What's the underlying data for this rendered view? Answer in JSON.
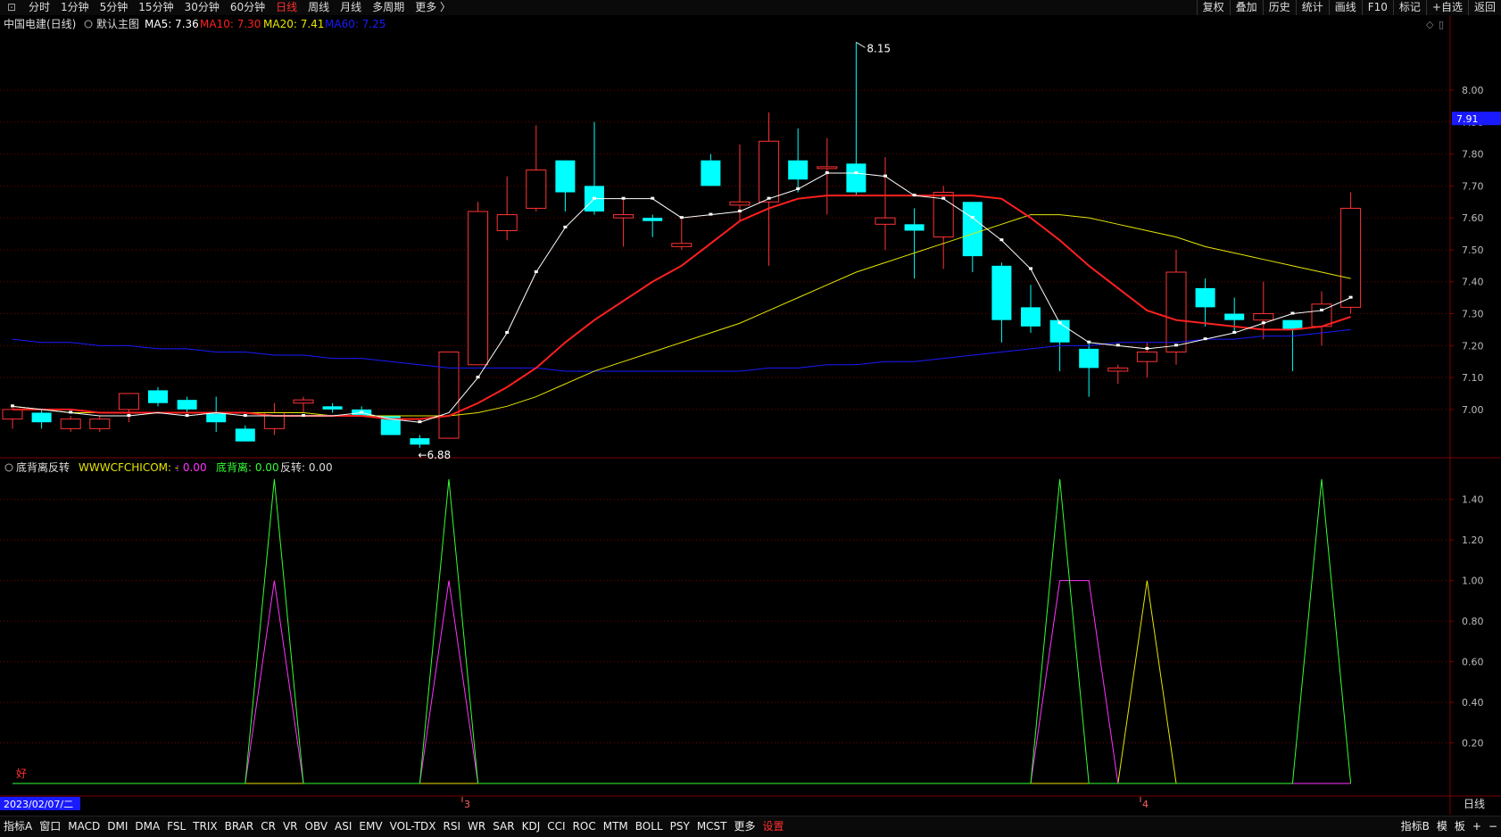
{
  "toolbar": {
    "left": [
      "分时",
      "1分钟",
      "5分钟",
      "15分钟",
      "30分钟",
      "60分钟",
      "日线",
      "周线",
      "月线",
      "多周期",
      "更多 〉"
    ],
    "active": "日线",
    "right": [
      "复权",
      "叠加",
      "历史",
      "统计",
      "画线",
      "F10",
      "标记",
      "+自选",
      "返回"
    ]
  },
  "main_header": {
    "stock": "中国电建(日线)",
    "style": "默认主图",
    "ma5_label": "MA5: 7.36",
    "ma10_label": "MA10: 7.30",
    "ma20_label": "MA20: 7.41",
    "ma60_label": "MA60: 7.25"
  },
  "indicator_header": {
    "name": "底背离反转",
    "site": "WWWCFCHICOM: -",
    "v1": ": 0.00",
    "v2": "底背离: 0.00",
    "v3": "反转: 0.00"
  },
  "colors": {
    "up": "#ff3333",
    "down": "#00ffff",
    "ma5": "#ffffff",
    "ma10": "#ff2020",
    "ma20": "#e6e600",
    "ma60": "#1a1aff",
    "ind_green": "#33ff33",
    "ind_magenta": "#ff33ff",
    "ind_yellow": "#e6e600",
    "grid": "#7a0000"
  },
  "current_price": "7.91",
  "date_label": "2023/02/07/二",
  "period_label": "日线",
  "month_labels": [
    "3",
    "4"
  ],
  "good_label": "好",
  "high_label": "8.15",
  "low_label": "6.88",
  "bottom_tabs": [
    "指标A",
    "窗口",
    "MACD",
    "DMI",
    "DMA",
    "FSL",
    "TRIX",
    "BRAR",
    "CR",
    "VR",
    "OBV",
    "ASI",
    "EMV",
    "VOL-TDX",
    "RSI",
    "WR",
    "SAR",
    "KDJ",
    "CCI",
    "ROC",
    "MTM",
    "BOLL",
    "PSY",
    "MCST",
    "更多",
    "设置"
  ],
  "bottom_right": [
    "指标B",
    "模",
    "板",
    "+",
    "−"
  ],
  "chart_data": {
    "type": "candlestick",
    "price_axis": {
      "ticks": [
        7.0,
        7.1,
        7.2,
        7.3,
        7.4,
        7.5,
        7.6,
        7.7,
        7.8,
        7.9,
        8.0
      ],
      "labels": [
        "7.00",
        "7.10",
        "7.20",
        "7.30",
        "7.40",
        "7.50",
        "7.60",
        "7.70",
        "7.80",
        "7.90",
        "8.00"
      ]
    },
    "indicator_axis": {
      "ticks": [
        0.2,
        0.4,
        0.6,
        0.8,
        1.0,
        1.2,
        1.4
      ],
      "labels": [
        "0.20",
        "0.40",
        "0.60",
        "0.80",
        "1.00",
        "1.20",
        "1.40"
      ]
    },
    "candles": [
      {
        "o": 6.97,
        "c": 7.0,
        "h": 7.01,
        "l": 6.94
      },
      {
        "o": 6.99,
        "c": 6.96,
        "h": 7.0,
        "l": 6.94
      },
      {
        "o": 6.94,
        "c": 6.97,
        "h": 6.98,
        "l": 6.93
      },
      {
        "o": 6.94,
        "c": 6.97,
        "h": 6.98,
        "l": 6.93
      },
      {
        "o": 7.0,
        "c": 7.05,
        "h": 7.05,
        "l": 6.96
      },
      {
        "o": 7.06,
        "c": 7.02,
        "h": 7.07,
        "l": 7.01
      },
      {
        "o": 7.03,
        "c": 7.0,
        "h": 7.04,
        "l": 6.99
      },
      {
        "o": 6.99,
        "c": 6.96,
        "h": 7.04,
        "l": 6.93
      },
      {
        "o": 6.94,
        "c": 6.9,
        "h": 6.95,
        "l": 6.9
      },
      {
        "o": 6.94,
        "c": 6.99,
        "h": 7.02,
        "l": 6.92
      },
      {
        "o": 7.02,
        "c": 7.03,
        "h": 7.04,
        "l": 6.99
      },
      {
        "o": 7.01,
        "c": 7.0,
        "h": 7.02,
        "l": 6.99
      },
      {
        "o": 7.0,
        "c": 6.98,
        "h": 7.01,
        "l": 6.98
      },
      {
        "o": 6.98,
        "c": 6.92,
        "h": 6.98,
        "l": 6.92
      },
      {
        "o": 6.91,
        "c": 6.89,
        "h": 6.92,
        "l": 6.88
      },
      {
        "o": 6.91,
        "c": 7.18,
        "h": 7.18,
        "l": 6.91
      },
      {
        "o": 7.14,
        "c": 7.62,
        "h": 7.65,
        "l": 7.14
      },
      {
        "o": 7.56,
        "c": 7.61,
        "h": 7.73,
        "l": 7.53
      },
      {
        "o": 7.63,
        "c": 7.75,
        "h": 7.89,
        "l": 7.62
      },
      {
        "o": 7.78,
        "c": 7.68,
        "h": 7.78,
        "l": 7.62
      },
      {
        "o": 7.7,
        "c": 7.62,
        "h": 7.9,
        "l": 7.61
      },
      {
        "o": 7.6,
        "c": 7.61,
        "h": 7.66,
        "l": 7.51
      },
      {
        "o": 7.6,
        "c": 7.59,
        "h": 7.61,
        "l": 7.54
      },
      {
        "o": 7.51,
        "c": 7.52,
        "h": 7.6,
        "l": 7.5
      },
      {
        "o": 7.78,
        "c": 7.7,
        "h": 7.8,
        "l": 7.7
      },
      {
        "o": 7.64,
        "c": 7.65,
        "h": 7.83,
        "l": 7.59
      },
      {
        "o": 7.65,
        "c": 7.84,
        "h": 7.93,
        "l": 7.45
      },
      {
        "o": 7.78,
        "c": 7.72,
        "h": 7.88,
        "l": 7.68
      },
      {
        "o": 7.76,
        "c": 7.76,
        "h": 7.85,
        "l": 7.61
      },
      {
        "o": 7.77,
        "c": 7.68,
        "h": 8.15,
        "l": 7.67
      },
      {
        "o": 7.58,
        "c": 7.6,
        "h": 7.79,
        "l": 7.5
      },
      {
        "o": 7.58,
        "c": 7.56,
        "h": 7.63,
        "l": 7.41
      },
      {
        "o": 7.54,
        "c": 7.68,
        "h": 7.7,
        "l": 7.44
      },
      {
        "o": 7.65,
        "c": 7.48,
        "h": 7.65,
        "l": 7.43
      },
      {
        "o": 7.45,
        "c": 7.28,
        "h": 7.46,
        "l": 7.21
      },
      {
        "o": 7.32,
        "c": 7.26,
        "h": 7.39,
        "l": 7.24
      },
      {
        "o": 7.28,
        "c": 7.21,
        "h": 7.28,
        "l": 7.12
      },
      {
        "o": 7.19,
        "c": 7.13,
        "h": 7.21,
        "l": 7.04
      },
      {
        "o": 7.12,
        "c": 7.13,
        "h": 7.14,
        "l": 7.08
      },
      {
        "o": 7.15,
        "c": 7.18,
        "h": 7.21,
        "l": 7.1
      },
      {
        "o": 7.18,
        "c": 7.43,
        "h": 7.5,
        "l": 7.14
      },
      {
        "o": 7.38,
        "c": 7.32,
        "h": 7.41,
        "l": 7.26
      },
      {
        "o": 7.3,
        "c": 7.28,
        "h": 7.35,
        "l": 7.24
      },
      {
        "o": 7.28,
        "c": 7.3,
        "h": 7.4,
        "l": 7.22
      },
      {
        "o": 7.28,
        "c": 7.25,
        "h": 7.28,
        "l": 7.12
      },
      {
        "o": 7.26,
        "c": 7.33,
        "h": 7.37,
        "l": 7.2
      },
      {
        "o": 7.32,
        "c": 7.63,
        "h": 7.68,
        "l": 7.3
      }
    ],
    "ma5": [
      7.01,
      7.0,
      6.99,
      6.98,
      6.98,
      6.99,
      6.98,
      6.99,
      6.98,
      6.98,
      6.98,
      6.98,
      6.99,
      6.97,
      6.96,
      6.99,
      7.1,
      7.24,
      7.43,
      7.57,
      7.66,
      7.66,
      7.66,
      7.6,
      7.61,
      7.62,
      7.66,
      7.69,
      7.74,
      7.74,
      7.73,
      7.67,
      7.66,
      7.6,
      7.53,
      7.44,
      7.27,
      7.21,
      7.2,
      7.19,
      7.2,
      7.22,
      7.24,
      7.27,
      7.3,
      7.31,
      7.35
    ],
    "ma10": [
      7.0,
      7.0,
      7.0,
      6.99,
      6.99,
      6.99,
      6.99,
      6.99,
      6.99,
      6.98,
      6.98,
      6.98,
      6.98,
      6.97,
      6.97,
      6.98,
      7.02,
      7.07,
      7.13,
      7.21,
      7.28,
      7.34,
      7.4,
      7.45,
      7.52,
      7.59,
      7.63,
      7.66,
      7.67,
      7.67,
      7.67,
      7.67,
      7.67,
      7.67,
      7.66,
      7.6,
      7.53,
      7.45,
      7.38,
      7.31,
      7.28,
      7.27,
      7.26,
      7.25,
      7.25,
      7.26,
      7.29
    ],
    "ma20": [
      7.01,
      7.0,
      6.99,
      6.99,
      6.99,
      6.99,
      6.99,
      6.99,
      6.99,
      6.99,
      6.99,
      6.98,
      6.98,
      6.98,
      6.98,
      6.98,
      6.99,
      7.01,
      7.04,
      7.08,
      7.12,
      7.15,
      7.18,
      7.21,
      7.24,
      7.27,
      7.31,
      7.35,
      7.39,
      7.43,
      7.46,
      7.49,
      7.52,
      7.55,
      7.58,
      7.61,
      7.61,
      7.6,
      7.58,
      7.56,
      7.54,
      7.51,
      7.49,
      7.47,
      7.45,
      7.43,
      7.41
    ],
    "ma60": [
      7.22,
      7.21,
      7.21,
      7.2,
      7.2,
      7.19,
      7.19,
      7.18,
      7.18,
      7.17,
      7.17,
      7.16,
      7.16,
      7.15,
      7.14,
      7.13,
      7.13,
      7.13,
      7.13,
      7.12,
      7.12,
      7.12,
      7.12,
      7.12,
      7.12,
      7.12,
      7.13,
      7.13,
      7.14,
      7.14,
      7.15,
      7.15,
      7.16,
      7.17,
      7.18,
      7.19,
      7.2,
      7.2,
      7.21,
      7.21,
      7.21,
      7.22,
      7.22,
      7.23,
      7.23,
      7.24,
      7.25
    ],
    "indicator": {
      "green": [
        0,
        0,
        0,
        0,
        0,
        0,
        0,
        0,
        0,
        1.5,
        0,
        0,
        0,
        0,
        0,
        1.5,
        0,
        0,
        0,
        0,
        0,
        0,
        0,
        0,
        0,
        0,
        0,
        0,
        0,
        0,
        0,
        0,
        0,
        0,
        0,
        0,
        1.5,
        0,
        0,
        0,
        0,
        0,
        0,
        0,
        0,
        1.5,
        0
      ],
      "magenta": [
        0,
        0,
        0,
        0,
        0,
        0,
        0,
        0,
        0,
        1.0,
        0,
        0,
        0,
        0,
        0,
        1.0,
        0,
        0,
        0,
        0,
        0,
        0,
        0,
        0,
        0,
        0,
        0,
        0,
        0,
        0,
        0,
        0,
        0,
        0,
        0,
        0,
        1.0,
        1.0,
        0,
        0,
        0,
        0,
        0,
        0,
        0,
        0,
        0
      ],
      "yellow": [
        0,
        0,
        0,
        0,
        0,
        0,
        0,
        0,
        0,
        0,
        0,
        0,
        0,
        0,
        0,
        0,
        0,
        0,
        0,
        0,
        0,
        0,
        0,
        0,
        0,
        0,
        0,
        0,
        0,
        0,
        0,
        0,
        0,
        0,
        0,
        0,
        0,
        0,
        0,
        1.0,
        0,
        0,
        0,
        0,
        0,
        0,
        0
      ]
    }
  }
}
